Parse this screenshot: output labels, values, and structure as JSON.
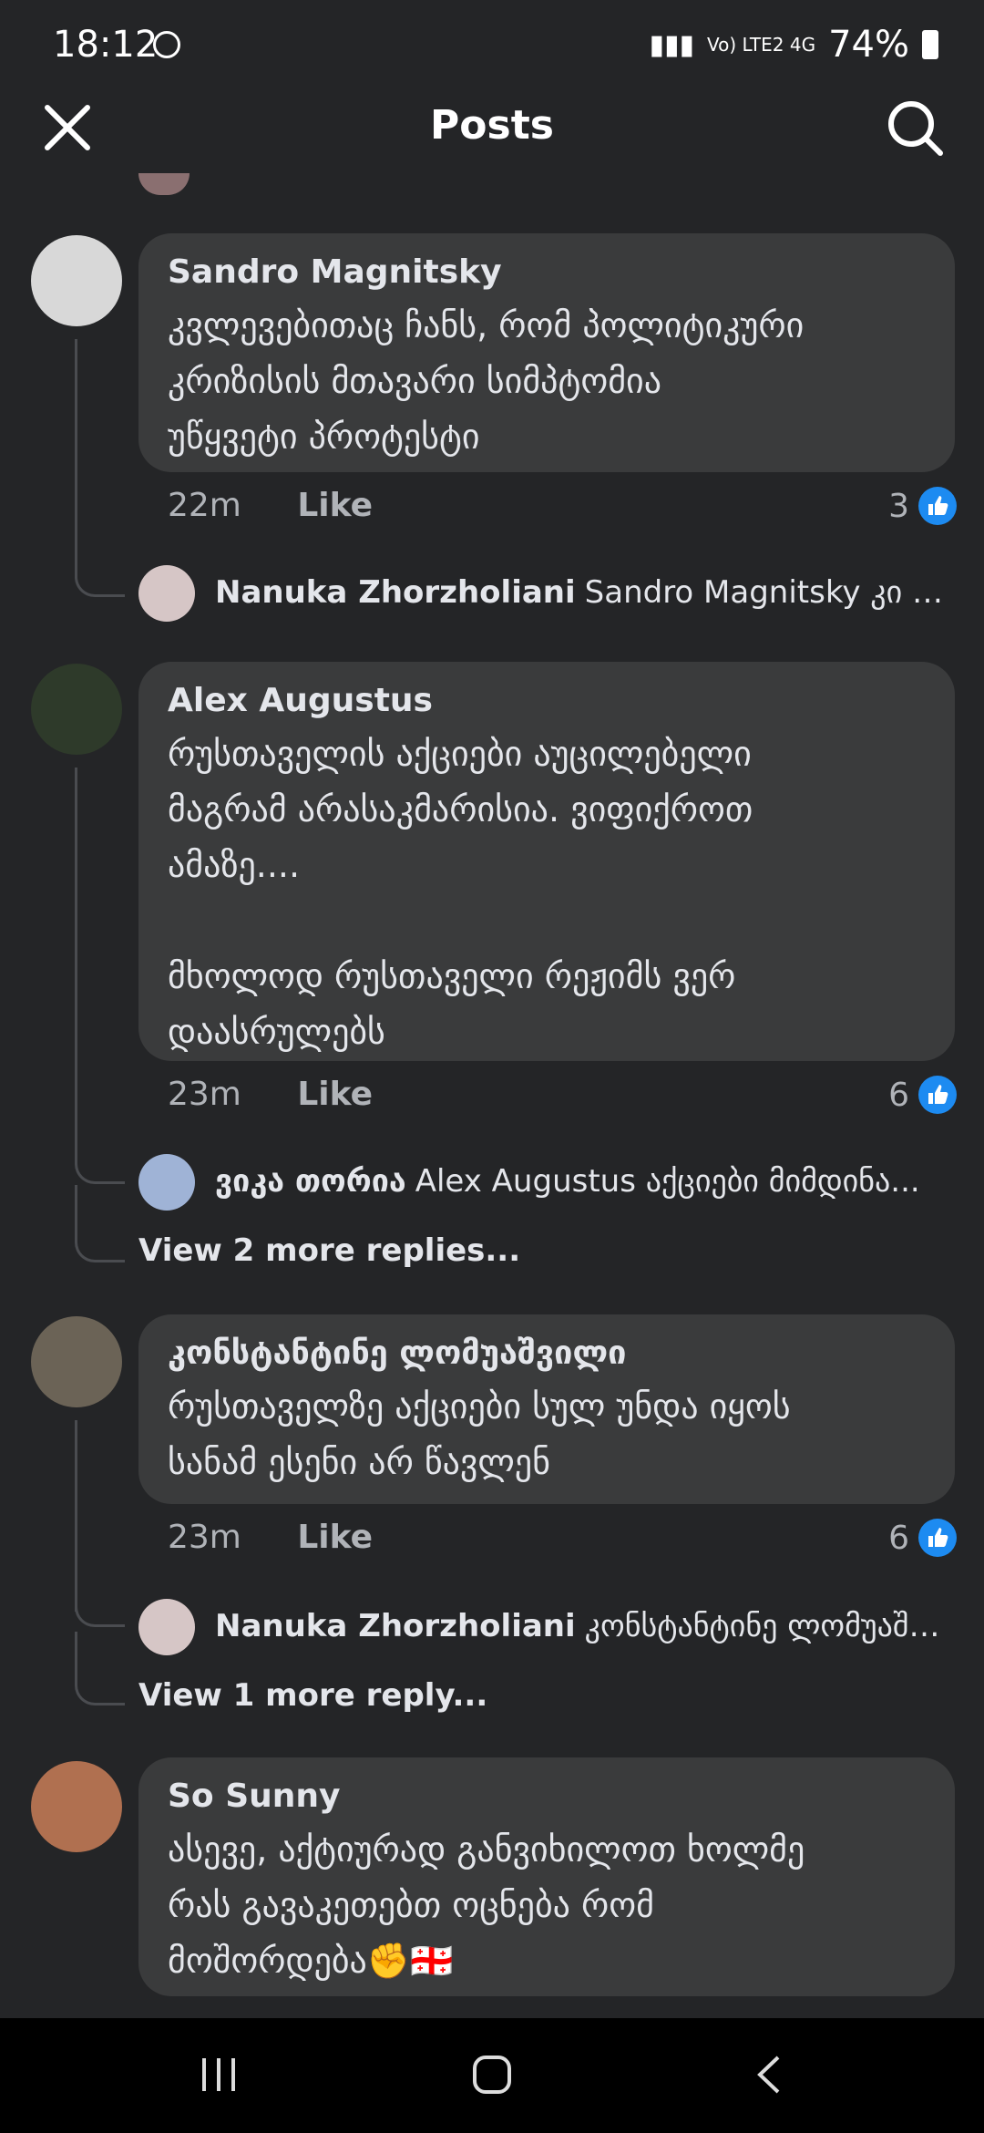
{
  "status_bar": {
    "time": "18:12",
    "battery": "74%",
    "network": "Vo) LTE2 4G"
  },
  "header": {
    "title": "Posts"
  },
  "comments": [
    {
      "author": "Sandro Magnitsky",
      "text": "კვლევებითაც ჩანს, რომ პოლიტიკური\nკრიზისის მთავარი სიმპტომია\nუწყვეტი პროტესტი",
      "time": "22m",
      "like_label": "Like",
      "likes": "3",
      "replies": [
        {
          "author": "Nanuka Zhorzholiani",
          "text": "Sandro Magnitsky კი და მე..."
        }
      ]
    },
    {
      "author": "Alex Augustus",
      "text": "რუსთაველის აქციები აუცილებელი\nმაგრამ არასაკმარისია. ვიფიქროთ\nამაზე....\n\nმხოლოდ რუსთაველი რეჟიმს ვერ\nდაასრულებს",
      "time": "23m",
      "like_label": "Like",
      "likes": "6",
      "replies": [
        {
          "author": "ვიკა თორია",
          "text": "Alex Augustus აქციები მიმდინა..."
        }
      ],
      "more_replies": "View 2 more replies..."
    },
    {
      "author": "კონსტანტინე ლომუაშვილი",
      "text": "რუსთაველზე აქციები სულ უნდა იყოს\nსანამ ესენი არ წავლენ",
      "time": "23m",
      "like_label": "Like",
      "likes": "6",
      "replies": [
        {
          "author": "Nanuka Zhorzholiani",
          "text": "კონსტანტინე ლომუაშვ..."
        }
      ],
      "more_replies": "View 1 more reply..."
    },
    {
      "author": "So Sunny",
      "text": "ასევე, აქტიურად განვიხილოთ ხოლმე\nრას გავაკეთებთ ოცნება რომ\nმოშორდება✊🇬🇪"
    }
  ],
  "colors": {
    "background": "#242527",
    "bubble": "#3a3b3c",
    "like_blue": "#1d8bf1"
  },
  "icons": [
    "close-icon",
    "search-icon",
    "like-thumb-icon",
    "recent-apps-icon",
    "home-icon",
    "back-icon"
  ]
}
